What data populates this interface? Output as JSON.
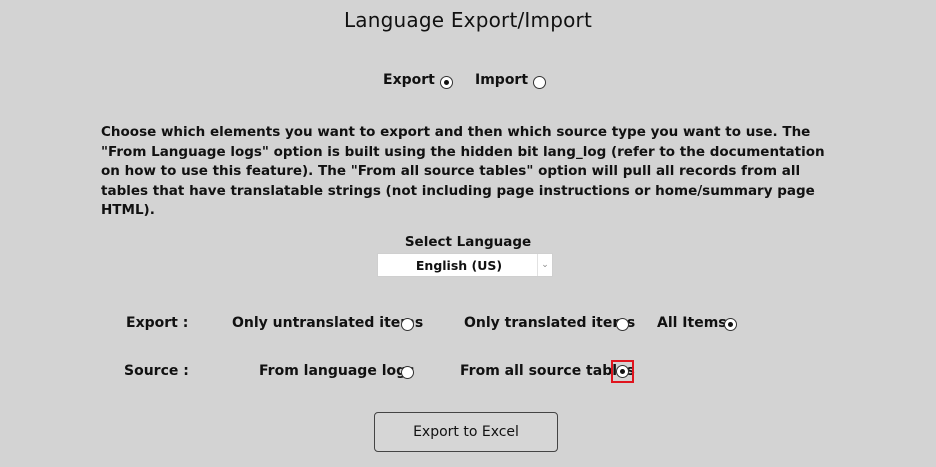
{
  "page": {
    "title": "Language Export/Import"
  },
  "mode": {
    "export_label": "Export",
    "import_label": "Import",
    "selected": "export"
  },
  "description": "Choose which elements you want to export and then which source type you want to use. The \"From Language logs\" option is built using the hidden bit lang_log (refer to the documentation on how to use this feature). The \"From all source tables\" option will pull all records from all tables that have translatable strings (not including page instructions or home/summary page HTML).",
  "language": {
    "label": "Select Language",
    "selected": "English (US)"
  },
  "export_options": {
    "label": "Export :",
    "untranslated": "Only untranslated items",
    "translated": "Only translated items",
    "all": "All Items",
    "selected": "all"
  },
  "source_options": {
    "label": "Source :",
    "logs": "From language logs",
    "all_tables": "From all source tables",
    "selected": "all_tables"
  },
  "actions": {
    "export_button": "Export to Excel"
  },
  "colors": {
    "background": "#d3d3d3",
    "highlight": "#e0141e"
  }
}
